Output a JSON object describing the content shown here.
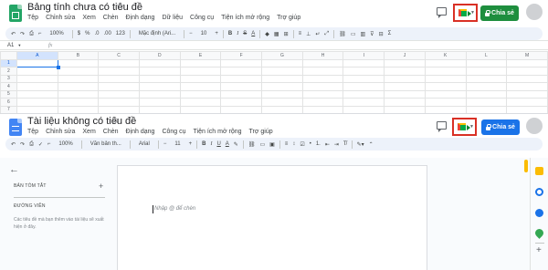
{
  "sheets": {
    "title": "Bảng tính chưa có tiêu đề",
    "menu": [
      "Tệp",
      "Chỉnh sửa",
      "Xem",
      "Chèn",
      "Định dạng",
      "Dữ liệu",
      "Công cụ",
      "Tiện ích mở rộng",
      "Trợ giúp"
    ],
    "share_label": "Chia sẻ",
    "toolbar": {
      "zoom": "100%",
      "currency": "$",
      "percent": "%",
      "decrease_decimal": ".0",
      "increase_decimal": ".00",
      "number_format": "123",
      "font": "Mặc định (Ari...",
      "font_size": "10"
    },
    "name_box": "A1",
    "fx": "fx",
    "columns": [
      "A",
      "B",
      "C",
      "D",
      "E",
      "F",
      "G",
      "H",
      "I",
      "J",
      "K",
      "L",
      "M"
    ],
    "rows": [
      "1",
      "2",
      "3",
      "4",
      "5",
      "6",
      "7"
    ]
  },
  "docs": {
    "title": "Tài liệu không có tiêu đề",
    "menu": [
      "Tệp",
      "Chỉnh sửa",
      "Xem",
      "Chèn",
      "Định dạng",
      "Công cụ",
      "Tiện ích mở rộng",
      "Trợ giúp"
    ],
    "share_label": "Chia sẻ",
    "toolbar": {
      "zoom": "100%",
      "style": "Văn bản th...",
      "font": "Arial",
      "font_size": "11"
    },
    "outline": {
      "summary_label": "BẢN TÓM TẮT",
      "outline_label": "ĐƯỜNG VIỀN",
      "hint": "Các tiêu đề mà bạn thêm vào tài liệu sẽ xuất hiện ở đây."
    },
    "placeholder": "Nhập @ để chèn"
  },
  "colors": {
    "sheets_green": "#23a566",
    "docs_blue": "#4285f4",
    "share_green": "#1e8e3e",
    "share_blue": "#1a73e8",
    "highlight_red": "#d93025",
    "toolbar_bg": "#edf2fa"
  },
  "icons": {
    "sheets_logo": "sheets-logo-icon",
    "docs_logo": "docs-logo-icon",
    "star": "star-icon",
    "comment": "comment-icon",
    "meet": "meet-icon",
    "lock": "lock-icon",
    "avatar": "avatar",
    "back": "back-arrow-icon"
  }
}
